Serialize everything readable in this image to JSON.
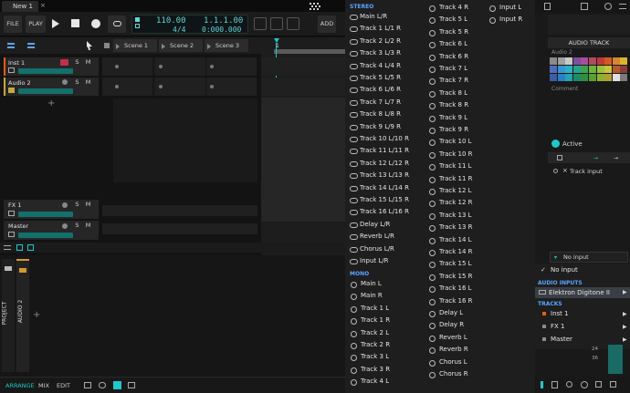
{
  "tab": {
    "name": "New 1"
  },
  "transport": {
    "file_label": "FILE",
    "play_label": "PLAY",
    "tempo": "110.00",
    "signature": "4/4",
    "position": "1.1.1.00",
    "time": "0:000.000",
    "add_label": "ADD"
  },
  "scenes": [
    "Scene 1",
    "Scene 2",
    "Scene 3"
  ],
  "ruler": {
    "bar": "1"
  },
  "tracks": [
    {
      "name": "Inst 1",
      "mute": "M",
      "solo": "S",
      "color": "#e85a19"
    },
    {
      "name": "Audio 2",
      "mute": "M",
      "solo": "S",
      "color": "#c8a642"
    }
  ],
  "effect_tracks": [
    {
      "name": "FX 1",
      "mute": "M",
      "solo": "S"
    },
    {
      "name": "Master",
      "mute": "M",
      "solo": "S"
    }
  ],
  "side_tabs": {
    "project": "PROJECT",
    "audio": "AUDIO 2"
  },
  "bottom_tabs": {
    "arrange": "ARRANGE",
    "mix": "MIX",
    "edit": "EDIT"
  },
  "routing": {
    "stereo_header": "STEREO",
    "mono_header": "MONO",
    "stereo": [
      "Main L/R",
      "Track 1 L/1 R",
      "Track 2 L/2 R",
      "Track 3 L/3 R",
      "Track 4 L/4 R",
      "Track 5 L/5 R",
      "Track 6 L/6 R",
      "Track 7 L/7 R",
      "Track 8 L/8 R",
      "Track 9 L/9 R",
      "Track 10 L/10 R",
      "Track 11 L/11 R",
      "Track 12 L/12 R",
      "Track 13 L/13 R",
      "Track 14 L/14 R",
      "Track 15 L/15 R",
      "Track 16 L/16 R",
      "Delay L/R",
      "Reverb L/R",
      "Chorus L/R",
      "Input L/R"
    ],
    "mono_col1": [
      "Main L",
      "Main R",
      "Track 1 L",
      "Track 1 R",
      "Track 2 L",
      "Track 2 R",
      "Track 3 L",
      "Track 3 R",
      "Track 4 L"
    ],
    "col2": [
      "Track 4 R",
      "Track 5 L",
      "Track 5 R",
      "Track 6 L",
      "Track 6 R",
      "Track 7 L",
      "Track 7 R",
      "Track 8 L",
      "Track 8 R",
      "Track 9 L",
      "Track 9 R",
      "Track 10 L",
      "Track 10 R",
      "Track 11 L",
      "Track 11 R",
      "Track 12 L",
      "Track 12 R",
      "Track 13 L",
      "Track 13 R",
      "Track 14 L",
      "Track 14 R",
      "Track 15 L",
      "Track 15 R",
      "Track 16 L",
      "Track 16 R",
      "Delay L",
      "Delay R",
      "Reverb L",
      "Reverb R",
      "Chorus L",
      "Chorus R"
    ],
    "col3": [
      "Input L",
      "Input R"
    ]
  },
  "inspector": {
    "section_title": "AUDIO TRACK",
    "track_name": "Audio 2",
    "comment_placeholder": "Comment",
    "active_label": "Active",
    "track_input_label": "Track input",
    "no_input_select": "No input",
    "menu_no_input": "No input",
    "audio_inputs_header": "AUDIO INPUTS",
    "device": "Elektron Digitone II",
    "tracks_header": "TRACKS",
    "tracks": [
      {
        "name": "Inst 1",
        "color": "#e85a19"
      },
      {
        "name": "FX 1",
        "color": "#8a8a8a"
      },
      {
        "name": "Master",
        "color": "#8a8a8a"
      }
    ],
    "meter_24": "24",
    "meter_36": "36"
  },
  "palette": [
    "#8c8c8c",
    "#a0a0a0",
    "#c9c9c9",
    "#7e4f9e",
    "#a84e9e",
    "#b04a62",
    "#c03a3a",
    "#d35a25",
    "#d6862c",
    "#d9b72c",
    "#4f6fbf",
    "#3b95cf",
    "#2cb0c9",
    "#27a38a",
    "#3aa34f",
    "#6cb33c",
    "#9bc23a",
    "#c9c43a",
    "#b35b2c",
    "#8a3a3a",
    "#3a5fa3",
    "#2a7fc9",
    "#27a3b0",
    "#1f8a6a",
    "#2f8f3f",
    "#5a9f2f",
    "#8fb02f",
    "#b0a02f",
    "#e0e0e0",
    "#7a7a7a"
  ],
  "colors": {
    "accent": "#1ec9c9",
    "blue": "#5aa6ff",
    "orange": "#e85a19"
  }
}
